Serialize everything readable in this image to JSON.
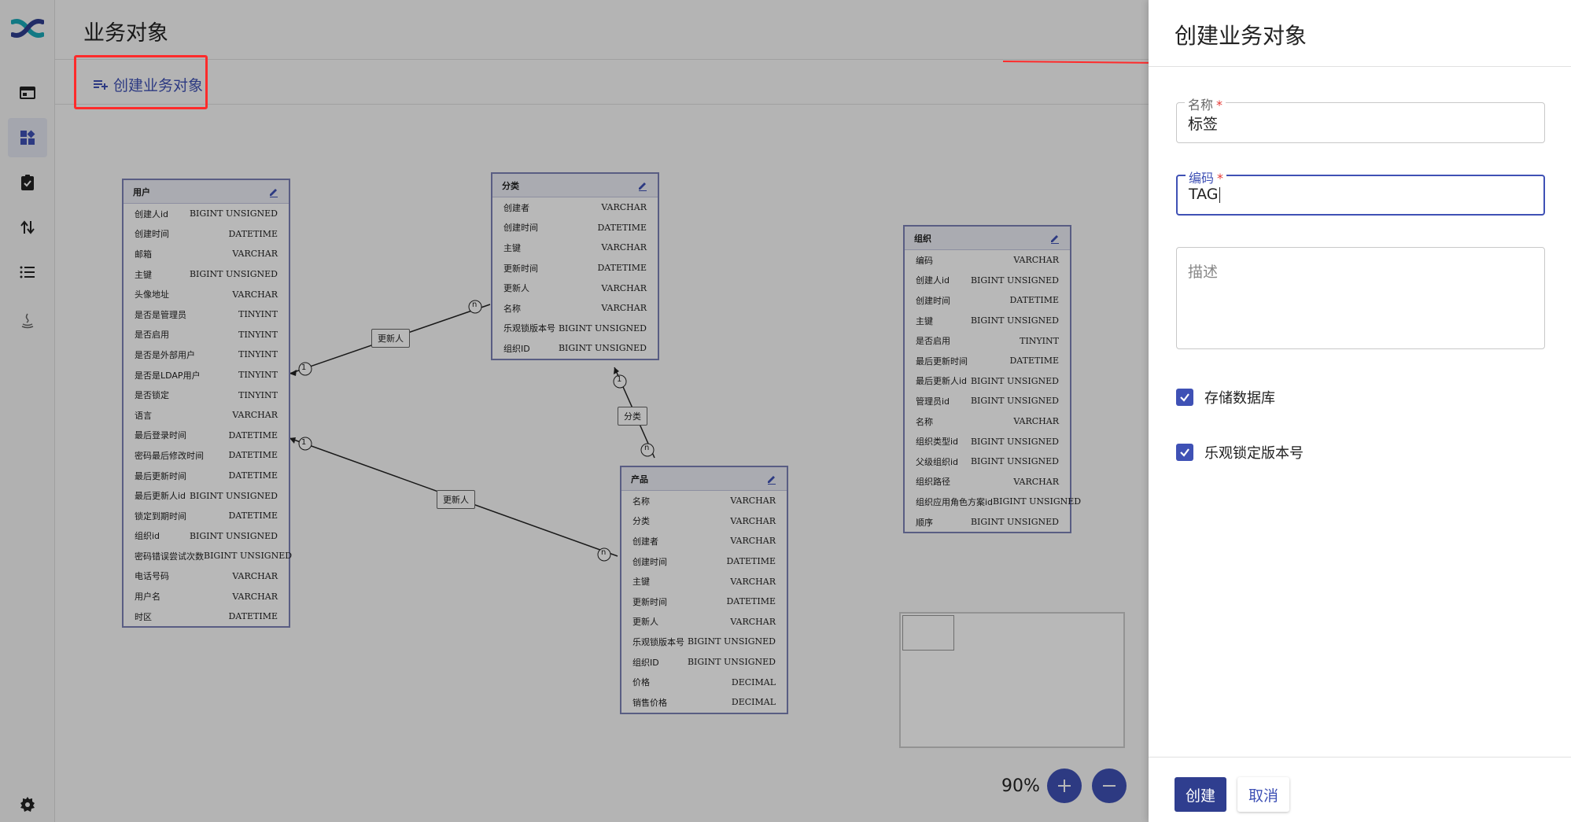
{
  "page": {
    "title": "业务对象",
    "create_link": "创建业务对象"
  },
  "sidebar": {
    "items": [
      {
        "name": "window-icon"
      },
      {
        "name": "dashboard-icon",
        "active": true
      },
      {
        "name": "clipboard-check-icon"
      },
      {
        "name": "swap-vertical-icon"
      },
      {
        "name": "list-icon"
      },
      {
        "name": "java-icon"
      }
    ],
    "settings": "gear-icon"
  },
  "er": {
    "tables": [
      {
        "id": "user",
        "title": "用户",
        "fields": [
          [
            "创建人id",
            "BIGINT UNSIGNED"
          ],
          [
            "创建时间",
            "DATETIME"
          ],
          [
            "邮箱",
            "VARCHAR"
          ],
          [
            "主键",
            "BIGINT UNSIGNED"
          ],
          [
            "头像地址",
            "VARCHAR"
          ],
          [
            "是否是管理员",
            "TINYINT"
          ],
          [
            "是否启用",
            "TINYINT"
          ],
          [
            "是否是外部用户",
            "TINYINT"
          ],
          [
            "是否是LDAP用户",
            "TINYINT"
          ],
          [
            "是否锁定",
            "TINYINT"
          ],
          [
            "语言",
            "VARCHAR"
          ],
          [
            "最后登录时间",
            "DATETIME"
          ],
          [
            "密码最后修改时间",
            "DATETIME"
          ],
          [
            "最后更新时间",
            "DATETIME"
          ],
          [
            "最后更新人id",
            "BIGINT UNSIGNED"
          ],
          [
            "锁定到期时间",
            "DATETIME"
          ],
          [
            "组织id",
            "BIGINT UNSIGNED"
          ],
          [
            "密码错误尝试次数",
            "BIGINT UNSIGNED"
          ],
          [
            "电话号码",
            "VARCHAR"
          ],
          [
            "用户名",
            "VARCHAR"
          ],
          [
            "时区",
            "DATETIME"
          ]
        ]
      },
      {
        "id": "category",
        "title": "分类",
        "fields": [
          [
            "创建者",
            "VARCHAR"
          ],
          [
            "创建时间",
            "DATETIME"
          ],
          [
            "主键",
            "VARCHAR"
          ],
          [
            "更新时间",
            "DATETIME"
          ],
          [
            "更新人",
            "VARCHAR"
          ],
          [
            "名称",
            "VARCHAR"
          ],
          [
            "乐观锁版本号",
            "BIGINT UNSIGNED"
          ],
          [
            "组织ID",
            "BIGINT UNSIGNED"
          ]
        ]
      },
      {
        "id": "product",
        "title": "产品",
        "fields": [
          [
            "名称",
            "VARCHAR"
          ],
          [
            "分类",
            "VARCHAR"
          ],
          [
            "创建者",
            "VARCHAR"
          ],
          [
            "创建时间",
            "DATETIME"
          ],
          [
            "主键",
            "VARCHAR"
          ],
          [
            "更新时间",
            "DATETIME"
          ],
          [
            "更新人",
            "VARCHAR"
          ],
          [
            "乐观锁版本号",
            "BIGINT UNSIGNED"
          ],
          [
            "组织ID",
            "BIGINT UNSIGNED"
          ],
          [
            "价格",
            "DECIMAL"
          ],
          [
            "销售价格",
            "DECIMAL"
          ]
        ]
      },
      {
        "id": "org",
        "title": "组织",
        "fields": [
          [
            "编码",
            "VARCHAR"
          ],
          [
            "创建人id",
            "BIGINT UNSIGNED"
          ],
          [
            "创建时间",
            "DATETIME"
          ],
          [
            "主键",
            "BIGINT UNSIGNED"
          ],
          [
            "是否启用",
            "TINYINT"
          ],
          [
            "最后更新时间",
            "DATETIME"
          ],
          [
            "最后更新人id",
            "BIGINT UNSIGNED"
          ],
          [
            "管理员id",
            "BIGINT UNSIGNED"
          ],
          [
            "名称",
            "VARCHAR"
          ],
          [
            "组织类型id",
            "BIGINT UNSIGNED"
          ],
          [
            "父级组织id",
            "BIGINT UNSIGNED"
          ],
          [
            "组织路径",
            "VARCHAR"
          ],
          [
            "组织应用角色方案id",
            "BIGINT UNSIGNED"
          ],
          [
            "顺序",
            "BIGINT UNSIGNED"
          ]
        ]
      }
    ],
    "edges": [
      {
        "label": "更新人",
        "from_card": "1",
        "to_card": "n"
      },
      {
        "label": "分类",
        "from_card": "1",
        "to_card": "n"
      },
      {
        "label": "更新人",
        "from_card": "1",
        "to_card": "n"
      }
    ]
  },
  "zoom": {
    "level": "90%"
  },
  "drawer": {
    "title": "创建业务对象",
    "name_field": {
      "label": "名称",
      "value": "标签"
    },
    "code_field": {
      "label": "编码",
      "value": "TAG"
    },
    "desc_field": {
      "placeholder": "描述"
    },
    "checkboxes": [
      {
        "label": "存储数据库",
        "checked": true
      },
      {
        "label": "乐观锁定版本号",
        "checked": true
      }
    ],
    "create_button": "创建",
    "cancel_button": "取消"
  },
  "colors": {
    "accent": "#3f51b5",
    "highlight": "#ff2b2b",
    "primary_button": "#2f3e8f"
  }
}
